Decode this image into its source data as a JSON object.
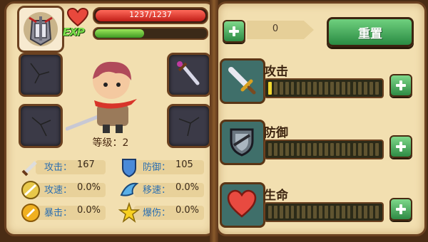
{
  "hp": {
    "text": "1237/1237",
    "fraction": 1.0,
    "color": "#d9231b"
  },
  "exp": {
    "label": "EXP",
    "fraction": 0.45,
    "color": "#5fc23a"
  },
  "hero": {
    "level_text": "等级：2"
  },
  "equipment": {
    "slots": [
      {
        "position": "top-left",
        "item": "empty"
      },
      {
        "position": "top-right",
        "item": "dagger-icon"
      },
      {
        "position": "bottom-left",
        "item": "empty"
      },
      {
        "position": "bottom-right",
        "item": "empty"
      }
    ]
  },
  "stats": [
    {
      "label": "攻击：",
      "value": "167",
      "icon": "sword-icon"
    },
    {
      "label": "防御：",
      "value": "105",
      "icon": "shield-icon"
    },
    {
      "label": "攻速：",
      "value": "0.0%",
      "icon": "attack-speed-icon"
    },
    {
      "label": "移速：",
      "value": "0.0%",
      "icon": "move-speed-icon"
    },
    {
      "label": "暴击：",
      "value": "0.0%",
      "icon": "crit-icon"
    },
    {
      "label": "爆伤：",
      "value": "0.0%",
      "icon": "crit-damage-icon"
    }
  ],
  "points": {
    "value": "0"
  },
  "reset_label": "重置",
  "attributes": [
    {
      "label": "攻击",
      "icon": "sword-icon",
      "filled": 1,
      "segments": 20
    },
    {
      "label": "防御",
      "icon": "shield-icon",
      "filled": 0,
      "segments": 20
    },
    {
      "label": "生命",
      "icon": "heart-icon",
      "filled": 0,
      "segments": 20
    }
  ]
}
